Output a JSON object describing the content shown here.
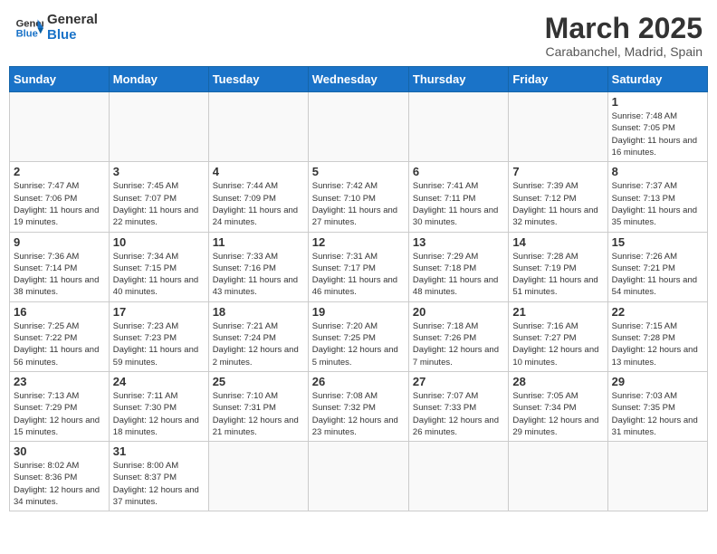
{
  "logo": {
    "line1": "General",
    "line2": "Blue"
  },
  "title": "March 2025",
  "location": "Carabanchel, Madrid, Spain",
  "weekdays": [
    "Sunday",
    "Monday",
    "Tuesday",
    "Wednesday",
    "Thursday",
    "Friday",
    "Saturday"
  ],
  "days": {
    "1": {
      "sunrise": "7:48 AM",
      "sunset": "7:05 PM",
      "daylight": "11 hours and 16 minutes."
    },
    "2": {
      "sunrise": "7:47 AM",
      "sunset": "7:06 PM",
      "daylight": "11 hours and 19 minutes."
    },
    "3": {
      "sunrise": "7:45 AM",
      "sunset": "7:07 PM",
      "daylight": "11 hours and 22 minutes."
    },
    "4": {
      "sunrise": "7:44 AM",
      "sunset": "7:09 PM",
      "daylight": "11 hours and 24 minutes."
    },
    "5": {
      "sunrise": "7:42 AM",
      "sunset": "7:10 PM",
      "daylight": "11 hours and 27 minutes."
    },
    "6": {
      "sunrise": "7:41 AM",
      "sunset": "7:11 PM",
      "daylight": "11 hours and 30 minutes."
    },
    "7": {
      "sunrise": "7:39 AM",
      "sunset": "7:12 PM",
      "daylight": "11 hours and 32 minutes."
    },
    "8": {
      "sunrise": "7:37 AM",
      "sunset": "7:13 PM",
      "daylight": "11 hours and 35 minutes."
    },
    "9": {
      "sunrise": "7:36 AM",
      "sunset": "7:14 PM",
      "daylight": "11 hours and 38 minutes."
    },
    "10": {
      "sunrise": "7:34 AM",
      "sunset": "7:15 PM",
      "daylight": "11 hours and 40 minutes."
    },
    "11": {
      "sunrise": "7:33 AM",
      "sunset": "7:16 PM",
      "daylight": "11 hours and 43 minutes."
    },
    "12": {
      "sunrise": "7:31 AM",
      "sunset": "7:17 PM",
      "daylight": "11 hours and 46 minutes."
    },
    "13": {
      "sunrise": "7:29 AM",
      "sunset": "7:18 PM",
      "daylight": "11 hours and 48 minutes."
    },
    "14": {
      "sunrise": "7:28 AM",
      "sunset": "7:19 PM",
      "daylight": "11 hours and 51 minutes."
    },
    "15": {
      "sunrise": "7:26 AM",
      "sunset": "7:21 PM",
      "daylight": "11 hours and 54 minutes."
    },
    "16": {
      "sunrise": "7:25 AM",
      "sunset": "7:22 PM",
      "daylight": "11 hours and 56 minutes."
    },
    "17": {
      "sunrise": "7:23 AM",
      "sunset": "7:23 PM",
      "daylight": "11 hours and 59 minutes."
    },
    "18": {
      "sunrise": "7:21 AM",
      "sunset": "7:24 PM",
      "daylight": "12 hours and 2 minutes."
    },
    "19": {
      "sunrise": "7:20 AM",
      "sunset": "7:25 PM",
      "daylight": "12 hours and 5 minutes."
    },
    "20": {
      "sunrise": "7:18 AM",
      "sunset": "7:26 PM",
      "daylight": "12 hours and 7 minutes."
    },
    "21": {
      "sunrise": "7:16 AM",
      "sunset": "7:27 PM",
      "daylight": "12 hours and 10 minutes."
    },
    "22": {
      "sunrise": "7:15 AM",
      "sunset": "7:28 PM",
      "daylight": "12 hours and 13 minutes."
    },
    "23": {
      "sunrise": "7:13 AM",
      "sunset": "7:29 PM",
      "daylight": "12 hours and 15 minutes."
    },
    "24": {
      "sunrise": "7:11 AM",
      "sunset": "7:30 PM",
      "daylight": "12 hours and 18 minutes."
    },
    "25": {
      "sunrise": "7:10 AM",
      "sunset": "7:31 PM",
      "daylight": "12 hours and 21 minutes."
    },
    "26": {
      "sunrise": "7:08 AM",
      "sunset": "7:32 PM",
      "daylight": "12 hours and 23 minutes."
    },
    "27": {
      "sunrise": "7:07 AM",
      "sunset": "7:33 PM",
      "daylight": "12 hours and 26 minutes."
    },
    "28": {
      "sunrise": "7:05 AM",
      "sunset": "7:34 PM",
      "daylight": "12 hours and 29 minutes."
    },
    "29": {
      "sunrise": "7:03 AM",
      "sunset": "7:35 PM",
      "daylight": "12 hours and 31 minutes."
    },
    "30": {
      "sunrise": "8:02 AM",
      "sunset": "8:36 PM",
      "daylight": "12 hours and 34 minutes."
    },
    "31": {
      "sunrise": "8:00 AM",
      "sunset": "8:37 PM",
      "daylight": "12 hours and 37 minutes."
    }
  },
  "labels": {
    "sunrise": "Sunrise:",
    "sunset": "Sunset:",
    "daylight": "Daylight:"
  }
}
